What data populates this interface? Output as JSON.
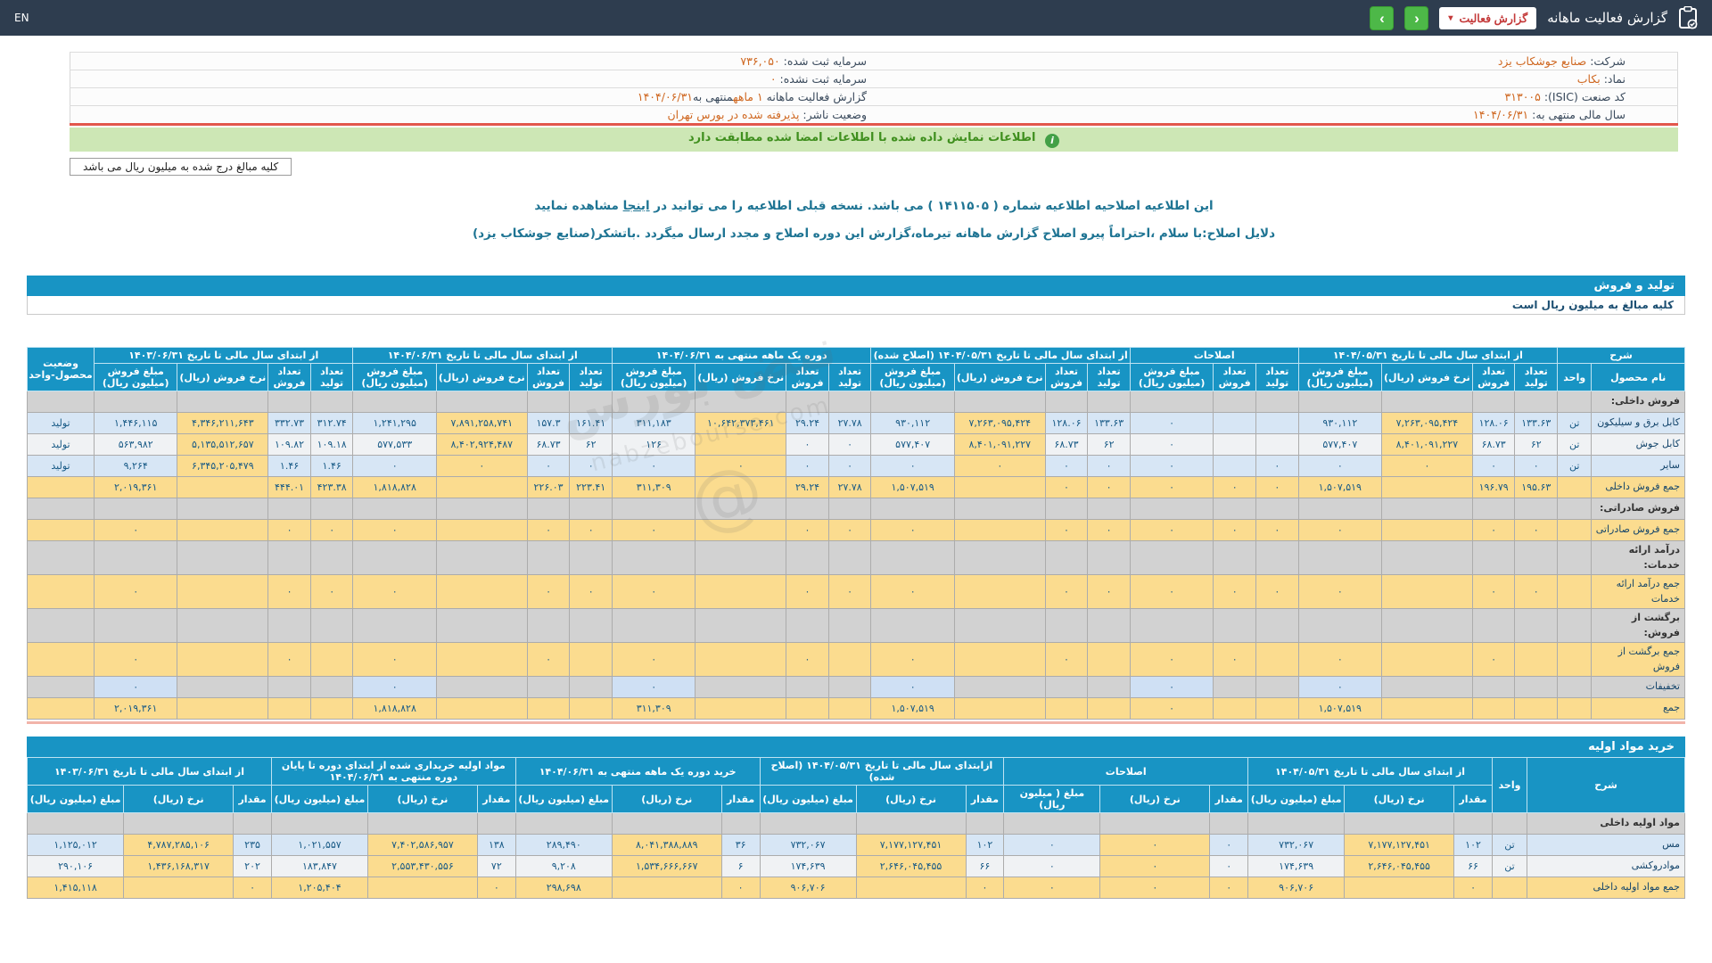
{
  "topbar": {
    "lang_toggle": "EN",
    "title": "گزارش فعالیت ماهانه",
    "report_button": "گزارش فعالیت",
    "caret": "▾",
    "nav_prev": "‹",
    "nav_next": "›"
  },
  "info_table": {
    "rows": [
      {
        "r_label": "شرکت:",
        "r_value": "صنایع جوشکاب یزد",
        "m_label": "سرمایه ثبت شده:",
        "m_value": "۷۳۶,۰۵۰"
      },
      {
        "r_label": "نماد:",
        "r_value": "بکاب",
        "m_label": "سرمایه ثبت نشده:",
        "m_value": "۰"
      },
      {
        "r_label": "کد صنعت (ISIC):",
        "r_value": "۳۱۳۰۰۵",
        "m_label": "گزارش فعالیت ماهانه",
        "m_value": "۱ ماهه",
        "m_label2": "منتهی به",
        "m_value2": "۱۴۰۴/۰۶/۳۱"
      },
      {
        "r_label": "سال مالی منتهی به:",
        "r_value": "۱۴۰۴/۰۶/۳۱",
        "m_label": "وضعیت ناشر:",
        "m_value": "پذیرفته شده در بورس تهران"
      }
    ]
  },
  "green_notice": {
    "icon": "i",
    "text": "اطلاعات نمایش داده شده با اطلاعات امضا شده مطابقت دارد"
  },
  "unit_note": "کلیه مبالغ درج شده به میلیون ریال می باشد",
  "amendment": {
    "before_link": "این اطلاعیه اصلاحیه اطلاعیه شماره ( ۱۴۱۱۵۰۵ ) می باشد. نسخه قبلی اطلاعیه را می توانید در ",
    "link": "اینجا",
    "after_link": " مشاهده نمایید",
    "reason": "دلایل اصلاح:با سلام ،احتراماً پیرو اصلاح گزارش ماهانه تیرماه،گزارش این دوره اصلاح و مجدد ارسال میگردد .باتشکر(صنایع جوشکاب یزد)"
  },
  "sales": {
    "title": "تولید و فروش",
    "unit_row": "کلیه مبالغ به میلیون ریال است",
    "widths": {
      "name": "5.6%",
      "unit": "2.05%",
      "status": "4%",
      "cnt": "2.55%",
      "rate": "5.45%",
      "amt": "5.0%"
    },
    "header": {
      "desc": "شرح",
      "name": "نام محصول",
      "unit": "واحد",
      "status": "وضعیت محصول-واحد",
      "groups": [
        {
          "label": "از ابتدای سال مالی تا تاریخ ۱۴۰۴/۰۵/۳۱",
          "cols": [
            "تعداد تولید",
            "تعداد فروش",
            "نرخ فروش (ریال)",
            "مبلغ فروش (میلیون ریال)"
          ]
        },
        {
          "label": "اصلاحات",
          "cols": [
            "تعداد تولید",
            "تعداد فروش",
            "مبلغ فروش (میلیون ریال)"
          ]
        },
        {
          "label": "از ابتدای سال مالی تا تاریخ ۱۴۰۴/۰۵/۳۱ (اصلاح شده)",
          "cols": [
            "تعداد تولید",
            "تعداد فروش",
            "نرخ فروش (ریال)",
            "مبلغ فروش (میلیون ریال)"
          ]
        },
        {
          "label": "دوره یک ماهه منتهی به ۱۴۰۴/۰۶/۳۱",
          "cols": [
            "تعداد تولید",
            "تعداد فروش",
            "نرخ فروش (ریال)",
            "مبلغ فروش (میلیون ریال)"
          ]
        },
        {
          "label": "از ابتدای سال مالی تا تاریخ ۱۴۰۴/۰۶/۳۱",
          "cols": [
            "تعداد تولید",
            "تعداد فروش",
            "نرخ فروش (ریال)",
            "مبلغ فروش (میلیون ریال)"
          ]
        },
        {
          "label": "از ابتدای سال مالی تا تاریخ ۱۴۰۳/۰۶/۳۱",
          "cols": [
            "تعداد تولید",
            "تعداد فروش",
            "نرخ فروش (ریال)",
            "مبلغ فروش (میلیون ریال)"
          ]
        }
      ]
    },
    "rows": [
      {
        "type": "section",
        "name": "فروش داخلی:"
      },
      {
        "type": "product",
        "shade": "blue",
        "name": "کابل برق و سیلیکون",
        "unit": "تن",
        "status": "تولید",
        "cells": [
          "۱۳۳.۶۳",
          "۱۲۸.۰۶",
          "۷,۲۶۳,۰۹۵,۴۲۴",
          "۹۳۰,۱۱۲",
          "",
          "",
          "۰",
          "۱۳۳.۶۳",
          "۱۲۸.۰۶",
          "۷,۲۶۳,۰۹۵,۴۲۴",
          "۹۳۰,۱۱۲",
          "۲۷.۷۸",
          "۲۹.۲۴",
          "۱۰,۶۴۲,۳۷۳,۴۶۱",
          "۳۱۱,۱۸۳",
          "۱۶۱.۴۱",
          "۱۵۷.۳",
          "۷,۸۹۱,۲۵۸,۷۴۱",
          "۱,۲۴۱,۲۹۵",
          "۳۱۲.۷۴",
          "۳۳۲.۷۳",
          "۴,۳۴۶,۲۱۱,۶۴۳",
          "۱,۴۴۶,۱۱۵"
        ]
      },
      {
        "type": "product",
        "shade": "white",
        "name": "کابل جوش",
        "unit": "تن",
        "status": "تولید",
        "cells": [
          "۶۲",
          "۶۸.۷۳",
          "۸,۴۰۱,۰۹۱,۲۲۷",
          "۵۷۷,۴۰۷",
          "",
          "",
          "۰",
          "۶۲",
          "۶۸.۷۳",
          "۸,۴۰۱,۰۹۱,۲۲۷",
          "۵۷۷,۴۰۷",
          "۰",
          "۰",
          "",
          "۱۲۶",
          "۶۲",
          "۶۸.۷۳",
          "۸,۴۰۲,۹۲۴,۴۸۷",
          "۵۷۷,۵۳۳",
          "۱۰۹.۱۸",
          "۱۰۹.۸۲",
          "۵,۱۳۵,۵۱۲,۶۵۷",
          "۵۶۳,۹۸۲"
        ]
      },
      {
        "type": "product",
        "shade": "blue",
        "name": "سایر",
        "unit": "تن",
        "status": "تولید",
        "cells": [
          "۰",
          "۰",
          "۰",
          "۰",
          "۰",
          "",
          "۰",
          "۰",
          "۰",
          "۰",
          "۰",
          "۰",
          "۰",
          "۰",
          "۰",
          "۰",
          "۰",
          "۰",
          "۰",
          "۱.۴۶",
          "۱.۴۶",
          "۶,۳۴۵,۲۰۵,۴۷۹",
          "۹,۲۶۴"
        ]
      },
      {
        "type": "total",
        "name": "جمع فروش داخلی",
        "unit": "",
        "status": "",
        "cells": [
          "۱۹۵.۶۳",
          "۱۹۶.۷۹",
          "",
          "۱,۵۰۷,۵۱۹",
          "۰",
          "۰",
          "۰",
          "۰",
          "۰",
          "",
          "۱,۵۰۷,۵۱۹",
          "۲۷.۷۸",
          "۲۹.۲۴",
          "",
          "۳۱۱,۳۰۹",
          "۲۲۳.۴۱",
          "۲۲۶.۰۳",
          "",
          "۱,۸۱۸,۸۲۸",
          "۴۲۳.۳۸",
          "۴۴۴.۰۱",
          "",
          "۲,۰۱۹,۳۶۱"
        ]
      },
      {
        "type": "section",
        "name": "فروش صادراتی:"
      },
      {
        "type": "total",
        "name": "جمع فروش صادراتی",
        "unit": "",
        "status": "",
        "cells": [
          "۰",
          "۰",
          "",
          "۰",
          "۰",
          "۰",
          "۰",
          "۰",
          "۰",
          "",
          "۰",
          "۰",
          "۰",
          "",
          "۰",
          "۰",
          "۰",
          "",
          "۰",
          "۰",
          "۰",
          "",
          "۰"
        ]
      },
      {
        "type": "section",
        "name": "درآمد ارائه خدمات:"
      },
      {
        "type": "total",
        "name": "جمع درآمد ارائه خدمات",
        "unit": "",
        "status": "",
        "cells": [
          "۰",
          "۰",
          "",
          "۰",
          "۰",
          "۰",
          "۰",
          "۰",
          "۰",
          "",
          "۰",
          "۰",
          "۰",
          "",
          "۰",
          "۰",
          "۰",
          "",
          "۰",
          "۰",
          "۰",
          "",
          "۰"
        ]
      },
      {
        "type": "section",
        "name": "برگشت از فروش:"
      },
      {
        "type": "total",
        "name": "جمع برگشت از فروش",
        "unit": "",
        "status": "",
        "cells": [
          "",
          "۰",
          "",
          "۰",
          "",
          "۰",
          "۰",
          "",
          "۰",
          "",
          "۰",
          "",
          "۰",
          "",
          "۰",
          "",
          "۰",
          "",
          "۰",
          "",
          "۰",
          "",
          "۰"
        ]
      },
      {
        "type": "disc",
        "name": "تخفیفات",
        "unit": "",
        "status": "",
        "cells": [
          "",
          "",
          "",
          "۰",
          "",
          "",
          "۰",
          "",
          "",
          "",
          "۰",
          "",
          "",
          "",
          "۰",
          "",
          "",
          "",
          "۰",
          "",
          "",
          "",
          "۰"
        ]
      },
      {
        "type": "total",
        "name": "جمع",
        "unit": "",
        "status": "",
        "cells": [
          "",
          "",
          "",
          "۱,۵۰۷,۵۱۹",
          "",
          "",
          "۰",
          "",
          "",
          "",
          "۱,۵۰۷,۵۱۹",
          "",
          "",
          "",
          "۳۱۱,۳۰۹",
          "",
          "",
          "",
          "۱,۸۱۸,۸۲۸",
          "",
          "",
          "",
          "۲,۰۱۹,۳۶۱"
        ]
      }
    ]
  },
  "materials": {
    "title": "خرید مواد اولیه",
    "widths": {
      "name": "9.5%",
      "unit": "2.1%",
      "cnt": "2.3%",
      "rate": "6.6%",
      "amt": "5.8%"
    },
    "header": {
      "desc": "شرح",
      "unit": "واحد",
      "groups": [
        {
          "label": "از ابتدای سال مالی تا تاریخ ۱۴۰۴/۰۵/۳۱",
          "cols": [
            "مقدار",
            "نرخ (ریال)",
            "مبلغ (میلیون ریال)"
          ]
        },
        {
          "label": "اصلاحات",
          "cols": [
            "مقدار",
            "نرخ (ریال)",
            "مبلغ ( میلیون ریال)"
          ]
        },
        {
          "label": "ازابتدای سال مالی تا تاریخ ۱۴۰۴/۰۵/۳۱ (اصلاح شده)",
          "cols": [
            "مقدار",
            "نرخ (ریال)",
            "مبلغ (میلیون ریال)"
          ]
        },
        {
          "label": "خرید دوره یک ماهه منتهی به ۱۴۰۴/۰۶/۳۱",
          "cols": [
            "مقدار",
            "نرخ (ریال)",
            "مبلغ (میلیون ریال)"
          ]
        },
        {
          "label": "مواد اولیه خریداری شده از ابتدای دوره تا پایان دوره منتهی به ۱۴۰۴/۰۶/۳۱",
          "cols": [
            "مقدار",
            "نرخ (ریال)",
            "مبلغ (میلیون ریال)"
          ]
        },
        {
          "label": "از ابتدای سال مالی تا تاریخ ۱۴۰۳/۰۶/۳۱",
          "cols": [
            "مقدار",
            "نرخ (ریال)",
            "مبلغ (میلیون ریال)"
          ]
        }
      ]
    },
    "rows": [
      {
        "type": "section",
        "name": "مواد اولیه داخلی"
      },
      {
        "type": "product",
        "shade": "blue",
        "name": "مس",
        "unit": "تن",
        "cells": [
          "۱۰۲",
          "۷,۱۷۷,۱۲۷,۴۵۱",
          "۷۳۲,۰۶۷",
          "۰",
          "۰",
          "۰",
          "۱۰۲",
          "۷,۱۷۷,۱۲۷,۴۵۱",
          "۷۳۲,۰۶۷",
          "۳۶",
          "۸,۰۴۱,۳۸۸,۸۸۹",
          "۲۸۹,۴۹۰",
          "۱۳۸",
          "۷,۴۰۲,۵۸۶,۹۵۷",
          "۱,۰۲۱,۵۵۷",
          "۲۳۵",
          "۴,۷۸۷,۲۸۵,۱۰۶",
          "۱,۱۲۵,۰۱۲"
        ]
      },
      {
        "type": "product",
        "shade": "white",
        "name": "موادروکشی",
        "unit": "تن",
        "cells": [
          "۶۶",
          "۲,۶۴۶,۰۴۵,۴۵۵",
          "۱۷۴,۶۳۹",
          "۰",
          "۰",
          "۰",
          "۶۶",
          "۲,۶۴۶,۰۴۵,۴۵۵",
          "۱۷۴,۶۳۹",
          "۶",
          "۱,۵۳۴,۶۶۶,۶۶۷",
          "۹,۲۰۸",
          "۷۲",
          "۲,۵۵۳,۴۳۰,۵۵۶",
          "۱۸۳,۸۴۷",
          "۲۰۲",
          "۱,۴۳۶,۱۶۸,۳۱۷",
          "۲۹۰,۱۰۶"
        ]
      },
      {
        "type": "total",
        "name": "جمع مواد اولیه داخلی",
        "unit": "",
        "cells": [
          "۰",
          "",
          "۹۰۶,۷۰۶",
          "۰",
          "۰",
          "۰",
          "۰",
          "",
          "۹۰۶,۷۰۶",
          "۰",
          "",
          "۲۹۸,۶۹۸",
          "۰",
          "",
          "۱,۲۰۵,۴۰۴",
          "۰",
          "",
          "۱,۴۱۵,۱۱۸"
        ]
      }
    ]
  },
  "watermark": {
    "line1": "نبض بورس",
    "line2": "nabzebourse.com",
    "line3": "@"
  }
}
